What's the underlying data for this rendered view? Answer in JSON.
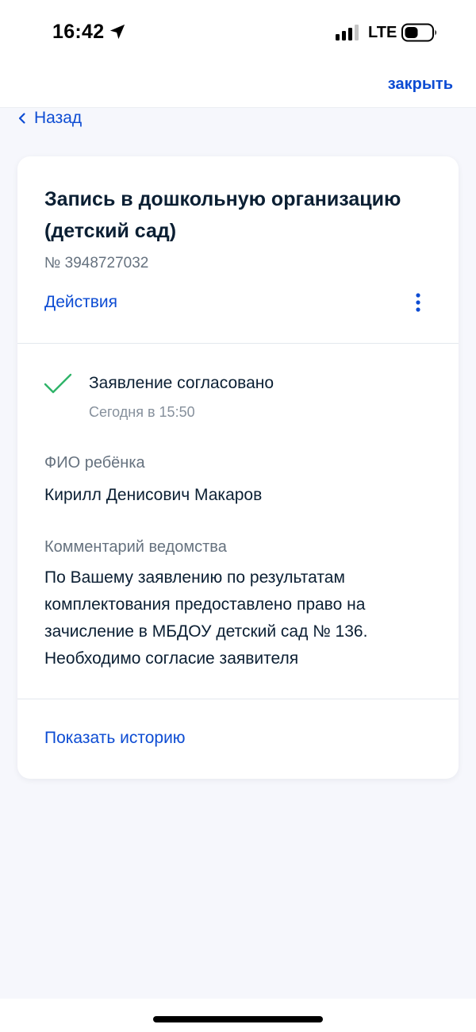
{
  "status_bar": {
    "time": "16:42",
    "network": "LTE",
    "icons": [
      "location-arrow-icon",
      "signal-icon",
      "battery-icon"
    ]
  },
  "top_bar": {
    "close_label": "закрыть"
  },
  "back": {
    "label": "Назад",
    "icon": "chevron-left-icon"
  },
  "card": {
    "title": "Запись в дошкольную организацию (детский сад)",
    "number": "№ 3948727032",
    "actions_label": "Действия",
    "menu_icon": "kebab-menu-icon",
    "status": {
      "icon": "checkmark-icon",
      "title": "Заявление согласовано",
      "time": "Сегодня в 15:50"
    },
    "child": {
      "label": "ФИО ребёнка",
      "value": "Кирилл Денисович Макаров"
    },
    "comment": {
      "label": "Комментарий ведомства",
      "value": "По Вашему заявлению по результатам комплектования предоставлено право на зачисление в МБДОУ детский сад № 136. Необходимо согласие заявителя"
    },
    "history_label": "Показать историю"
  },
  "colors": {
    "accent": "#0d4cd3",
    "success": "#2fb469",
    "text": "#0b1f33",
    "secondary_text": "#66727f",
    "background": "#f6f7fc"
  }
}
